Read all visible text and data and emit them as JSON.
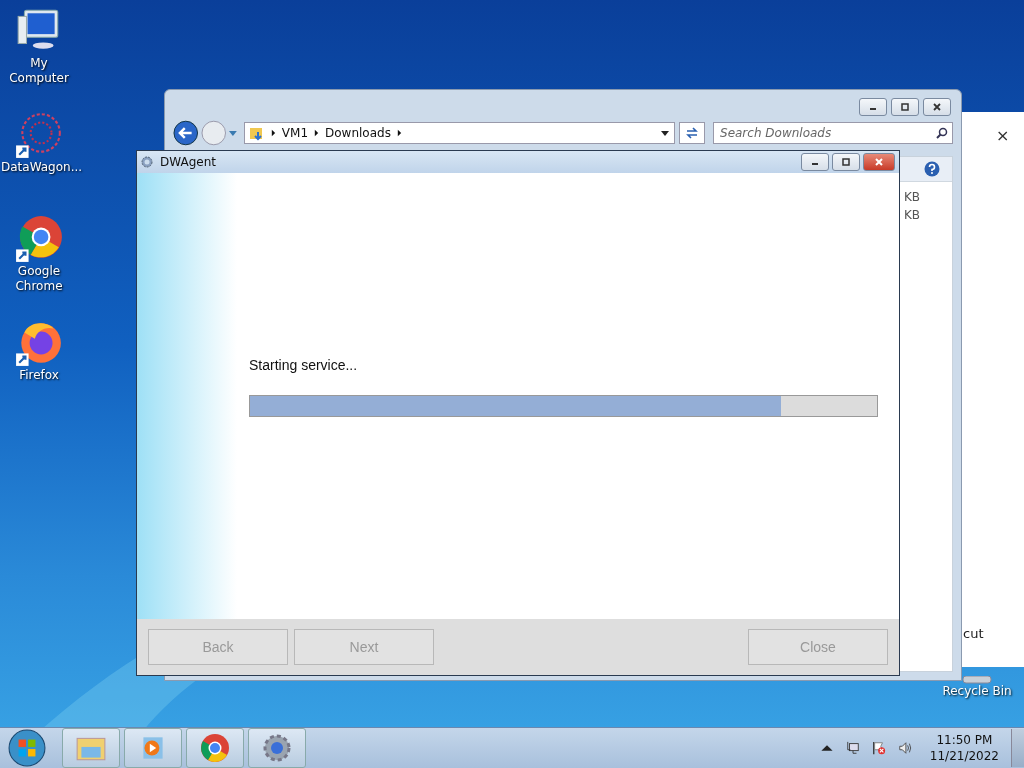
{
  "desktop_icons": [
    {
      "label": "My Computer",
      "kind": "computer"
    },
    {
      "label": "DataWagon...",
      "kind": "datawagon"
    },
    {
      "label": "Google Chrome",
      "kind": "chrome"
    },
    {
      "label": "Firefox",
      "kind": "firefox"
    }
  ],
  "background_window": {
    "close": "×",
    "text": "cut"
  },
  "recycle_bin": {
    "label": "Recycle Bin"
  },
  "explorer": {
    "breadcrumb": [
      "VM1",
      "Downloads"
    ],
    "search": {
      "placeholder": "Search Downloads"
    },
    "sizes": [
      "KB",
      "KB"
    ]
  },
  "dialog": {
    "title": "DWAgent",
    "status": "Starting service...",
    "progress": {
      "level": 0.847
    },
    "buttons": [
      {
        "label": "Back",
        "disabled": true
      },
      {
        "label": "Next",
        "disabled": true
      },
      {
        "label": "Close",
        "disabled": true
      }
    ]
  },
  "taskbar": {
    "items": [
      {
        "kind": "explorer",
        "selected": false
      },
      {
        "kind": "media",
        "selected": false
      },
      {
        "kind": "chrome",
        "selected": false
      },
      {
        "kind": "gear",
        "selected": false
      }
    ],
    "time": "11:50 PM",
    "date": "11/21/2022"
  }
}
